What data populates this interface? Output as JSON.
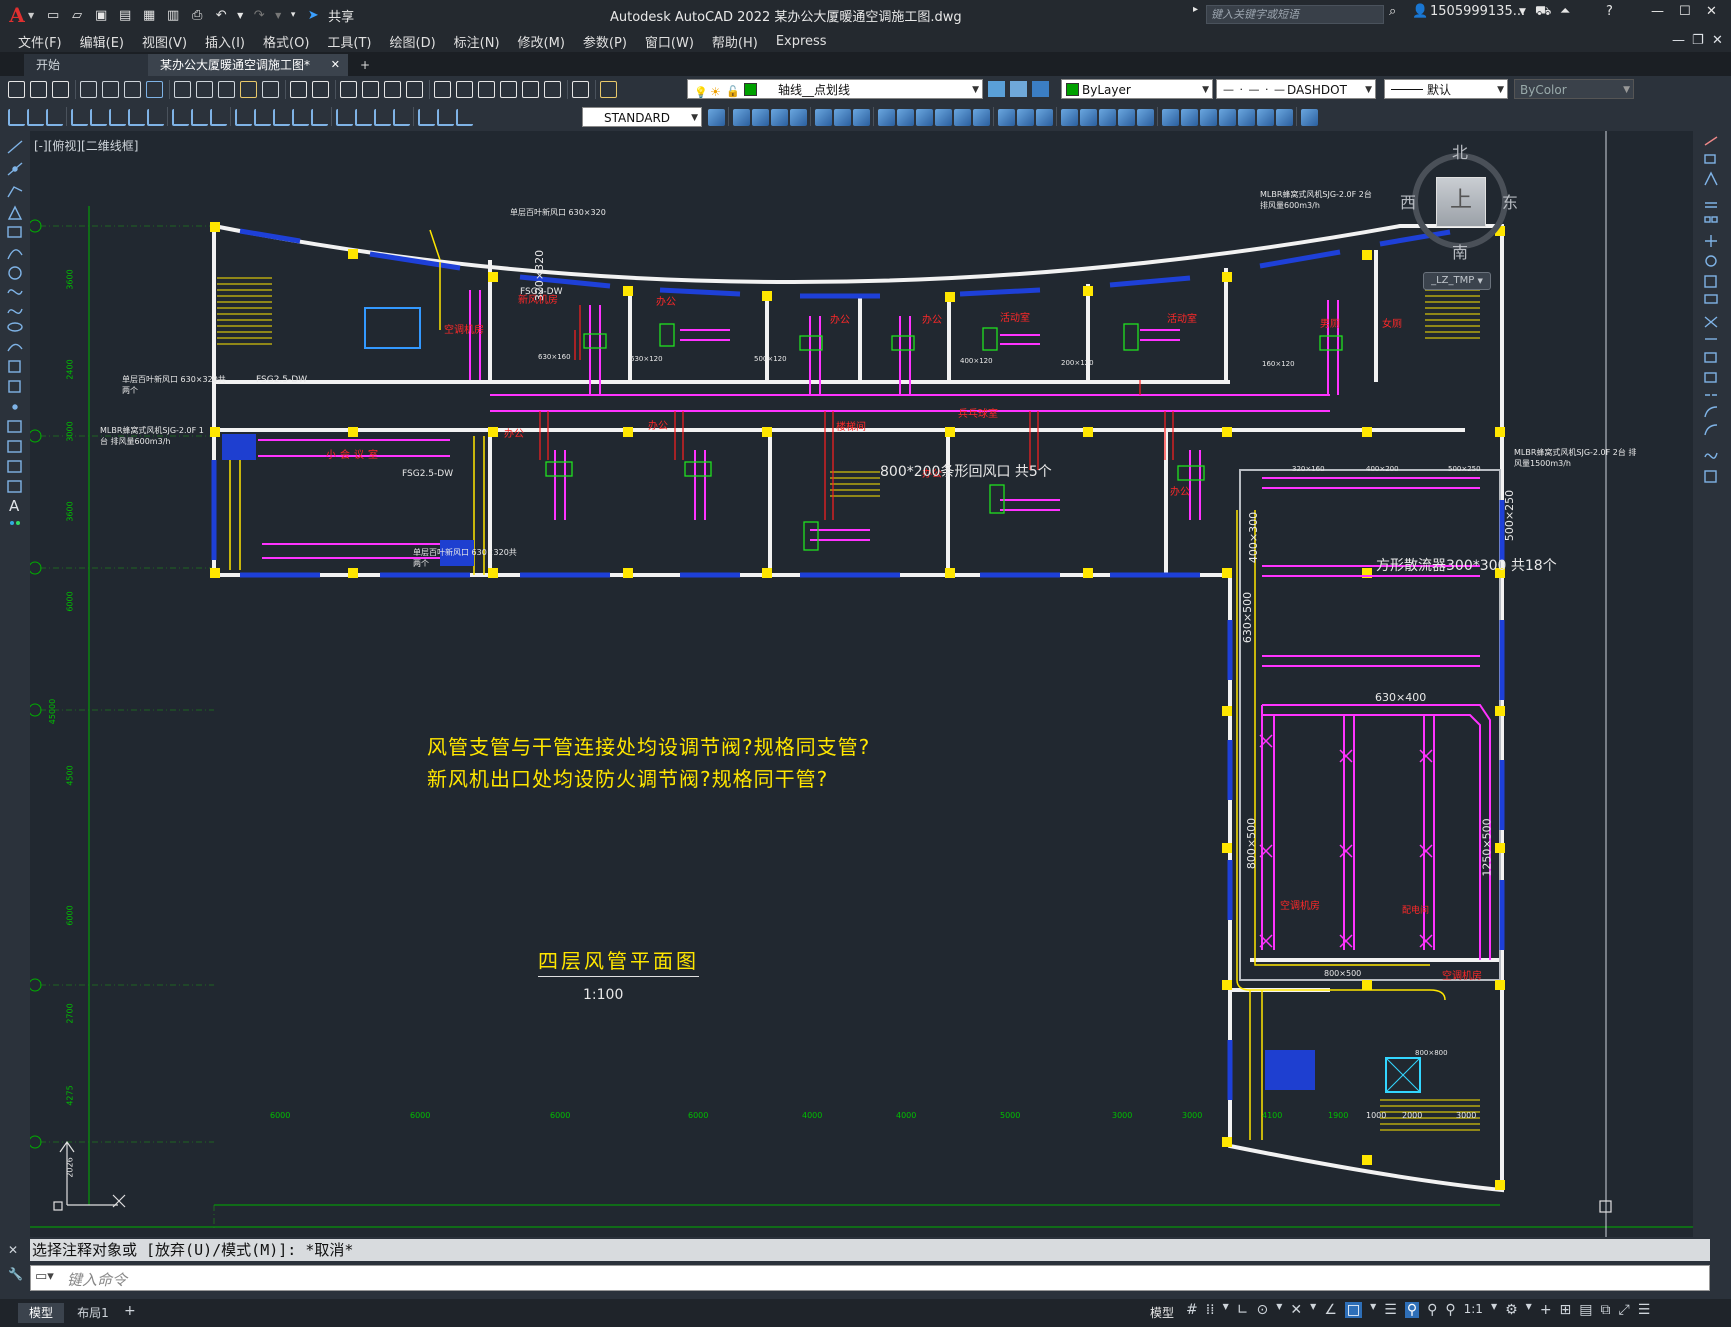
{
  "titlebar": {
    "app_title": "Autodesk AutoCAD 2022    某办公大厦暖通空调施工图.dwg",
    "share_label": "共享",
    "search_placeholder": "键入关键字或短语",
    "user_label": "1505999135...",
    "logo_letter": "A"
  },
  "menu": [
    "文件(F)",
    "编辑(E)",
    "视图(V)",
    "插入(I)",
    "格式(O)",
    "工具(T)",
    "绘图(D)",
    "标注(N)",
    "修改(M)",
    "参数(P)",
    "窗口(W)",
    "帮助(H)",
    "Express"
  ],
  "tabs": {
    "start": "开始",
    "active": "某办公大厦暖通空调施工图*",
    "add": "+"
  },
  "ribbon": {
    "layer_name": "轴线__点划线",
    "color": "ByLayer",
    "linetype": "DASHDOT",
    "lineweight": "默认",
    "plotstyle": "ByColor",
    "textstyle": "STANDARD"
  },
  "viewport_label": "[-][俯视][二维线框]",
  "viewcube": {
    "north": "北",
    "south": "南",
    "east": "东",
    "west": "西",
    "top": "上",
    "ucs": "_LZ_TMP"
  },
  "drawing": {
    "notes": [
      "风管支管与干管连接处均设调节阀?规格同支管?",
      "新风机出口处均设防火调节阀?规格同干管?"
    ],
    "plan_title": "四层风管平面图",
    "scale": "1:100",
    "room_labels": [
      "新风机房",
      "办公",
      "办公",
      "办公",
      "办公",
      "活动室",
      "活动室",
      "男厕",
      "女厕",
      "空调机房",
      "办公",
      "办公",
      "楼梯间",
      "兵乓球室",
      "办公",
      "小会议室",
      "办公",
      "空调机房",
      "空调机房",
      "配电间"
    ],
    "annotations": [
      "单层百叶新风口 630×320",
      "MLBR蜂窝式风机SJG-2.0F 2台 排风量600m3/h",
      "MLBR蜂窝式风机SJG-2.0F 1台 排风量600m3/h",
      "MLBR蜂窝式风机SJG-2.0F 2台 排风量1500m3/h",
      "单层百叶新风口 630×320共两个",
      "单层百叶新风口 630×320共两个",
      "800*200条形回风口 共5个",
      "方形散流器300*300 共18个",
      "FSG2.5-DW",
      "FSG2.5-DW",
      "FSG2-DW"
    ],
    "duct_sizes": [
      "630×160",
      "630×120",
      "500×120",
      "400×120",
      "200×120",
      "160×120",
      "400×300",
      "630×500",
      "630×400",
      "800×500",
      "1250×500",
      "800×500",
      "500×250",
      "320×160",
      "400×200",
      "500×250",
      "320×320",
      "800×800"
    ],
    "dims_bottom": [
      "6000",
      "6000",
      "6000",
      "6000",
      "4000",
      "4000",
      "5000",
      "3000",
      "3000",
      "4100",
      "1900",
      "1000",
      "2000",
      "3000"
    ],
    "dims_left": [
      "3600",
      "2400",
      "3000",
      "3600",
      "6000",
      "45000",
      "4500",
      "6000",
      "2700",
      "4275",
      "2026"
    ]
  },
  "command": {
    "history": "选择注释对象或 [放弃(U)/模式(M)]: *取消*",
    "placeholder": "键入命令"
  },
  "statusbar": {
    "tab_model": "模型",
    "tab_layout": "布局1",
    "add": "+",
    "model_label": "模型",
    "scale": "1:1"
  }
}
